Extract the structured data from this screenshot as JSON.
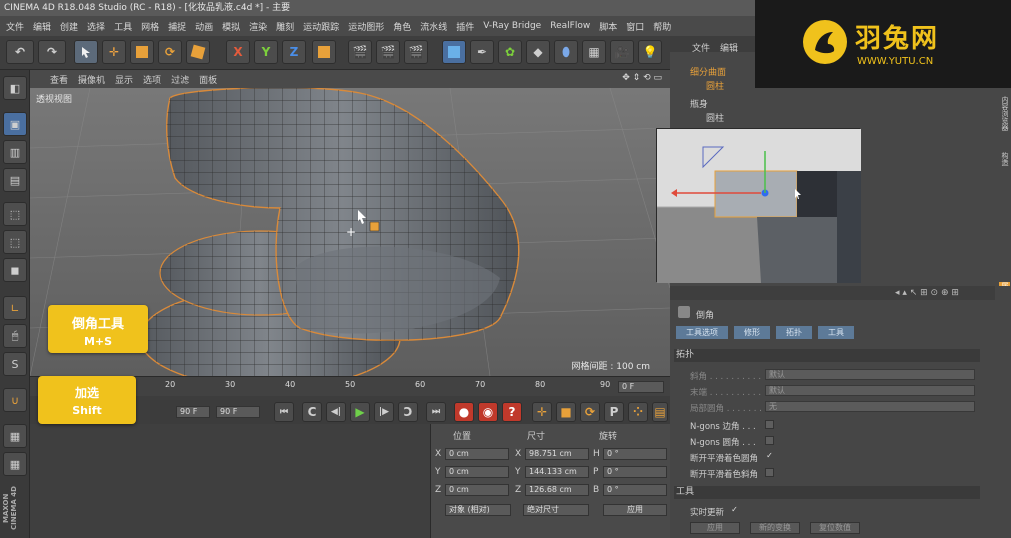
{
  "title": "CINEMA 4D R18.048 Studio (RC - R18) - [化妆品乳液.c4d *] - 主要",
  "menu": [
    "文件",
    "编辑",
    "创建",
    "选择",
    "工具",
    "网格",
    "捕捉",
    "动画",
    "模拟",
    "渲染",
    "雕刻",
    "运动跟踪",
    "运动图形",
    "角色",
    "流水线",
    "插件",
    "V-Ray Bridge",
    "RealFlow",
    "脚本",
    "窗口",
    "帮助"
  ],
  "toolbar": {
    "x": "X",
    "y": "Y",
    "z": "Z"
  },
  "viewport": {
    "menu": [
      "查看",
      "摄像机",
      "显示",
      "选项",
      "过滤",
      "面板"
    ],
    "label": "透视视图",
    "grid_info": "网格间距 : 100 cm"
  },
  "timeline": {
    "ticks": [
      "20",
      "30",
      "40",
      "50",
      "60",
      "70",
      "80",
      "90"
    ],
    "frame_field": "0 F",
    "end_field_a": "90 F",
    "end_field_b": "90 F"
  },
  "hints": {
    "bevel_title": "倒角工具",
    "bevel_key": "M+S",
    "add_title": "加选",
    "add_key": "Shift"
  },
  "coords": {
    "headers": [
      "位置",
      "尺寸",
      "旋转"
    ],
    "rows": [
      {
        "axis": "X",
        "pos": "0 cm",
        "size_axis": "X",
        "size": "98.751 cm",
        "rot_axis": "H",
        "rot": "0 °"
      },
      {
        "axis": "Y",
        "pos": "0 cm",
        "size_axis": "Y",
        "size": "144.133 cm",
        "rot_axis": "P",
        "rot": "0 °"
      },
      {
        "axis": "Z",
        "pos": "0 cm",
        "size_axis": "Z",
        "size": "126.68 cm",
        "rot_axis": "B",
        "rot": "0 °"
      }
    ],
    "mode_a": "对象 (相对)",
    "mode_b": "绝对尺寸",
    "apply": "应用"
  },
  "objects": {
    "tabs": [
      "文件",
      "编辑"
    ],
    "items": [
      "细分曲面",
      "圆柱",
      "瓶身",
      "圆柱"
    ]
  },
  "side_tabs": [
    "内容浏览器",
    "构造",
    "属性"
  ],
  "attributes": {
    "title": "倒角",
    "tabs": [
      "工具选项",
      "修形",
      "拓扑",
      "工具"
    ],
    "section_topology": "拓扑",
    "rows": [
      {
        "label": "斜角 . . . . . . . . . .",
        "value": "默认"
      },
      {
        "label": "末端 . . . . . . . . . .",
        "value": "默认"
      },
      {
        "label": "局部圆角 . . . . . . .",
        "value": "无"
      }
    ],
    "checks": [
      {
        "label": "N-gons 边角 . . .",
        "checked": false
      },
      {
        "label": "N-gons 圆角 . . .",
        "checked": false
      },
      {
        "label": "断开平滑着色圆角",
        "checked": true
      },
      {
        "label": "断开平滑着色斜角",
        "checked": false
      }
    ],
    "section_tool": "工具",
    "realtime": "实时更新",
    "buttons": [
      "应用",
      "新的变换",
      "复位数值"
    ]
  },
  "watermark": {
    "name": "羽兔网",
    "url": "WWW.YUTU.CN"
  },
  "maxon": "MAXON CINEMA 4D"
}
